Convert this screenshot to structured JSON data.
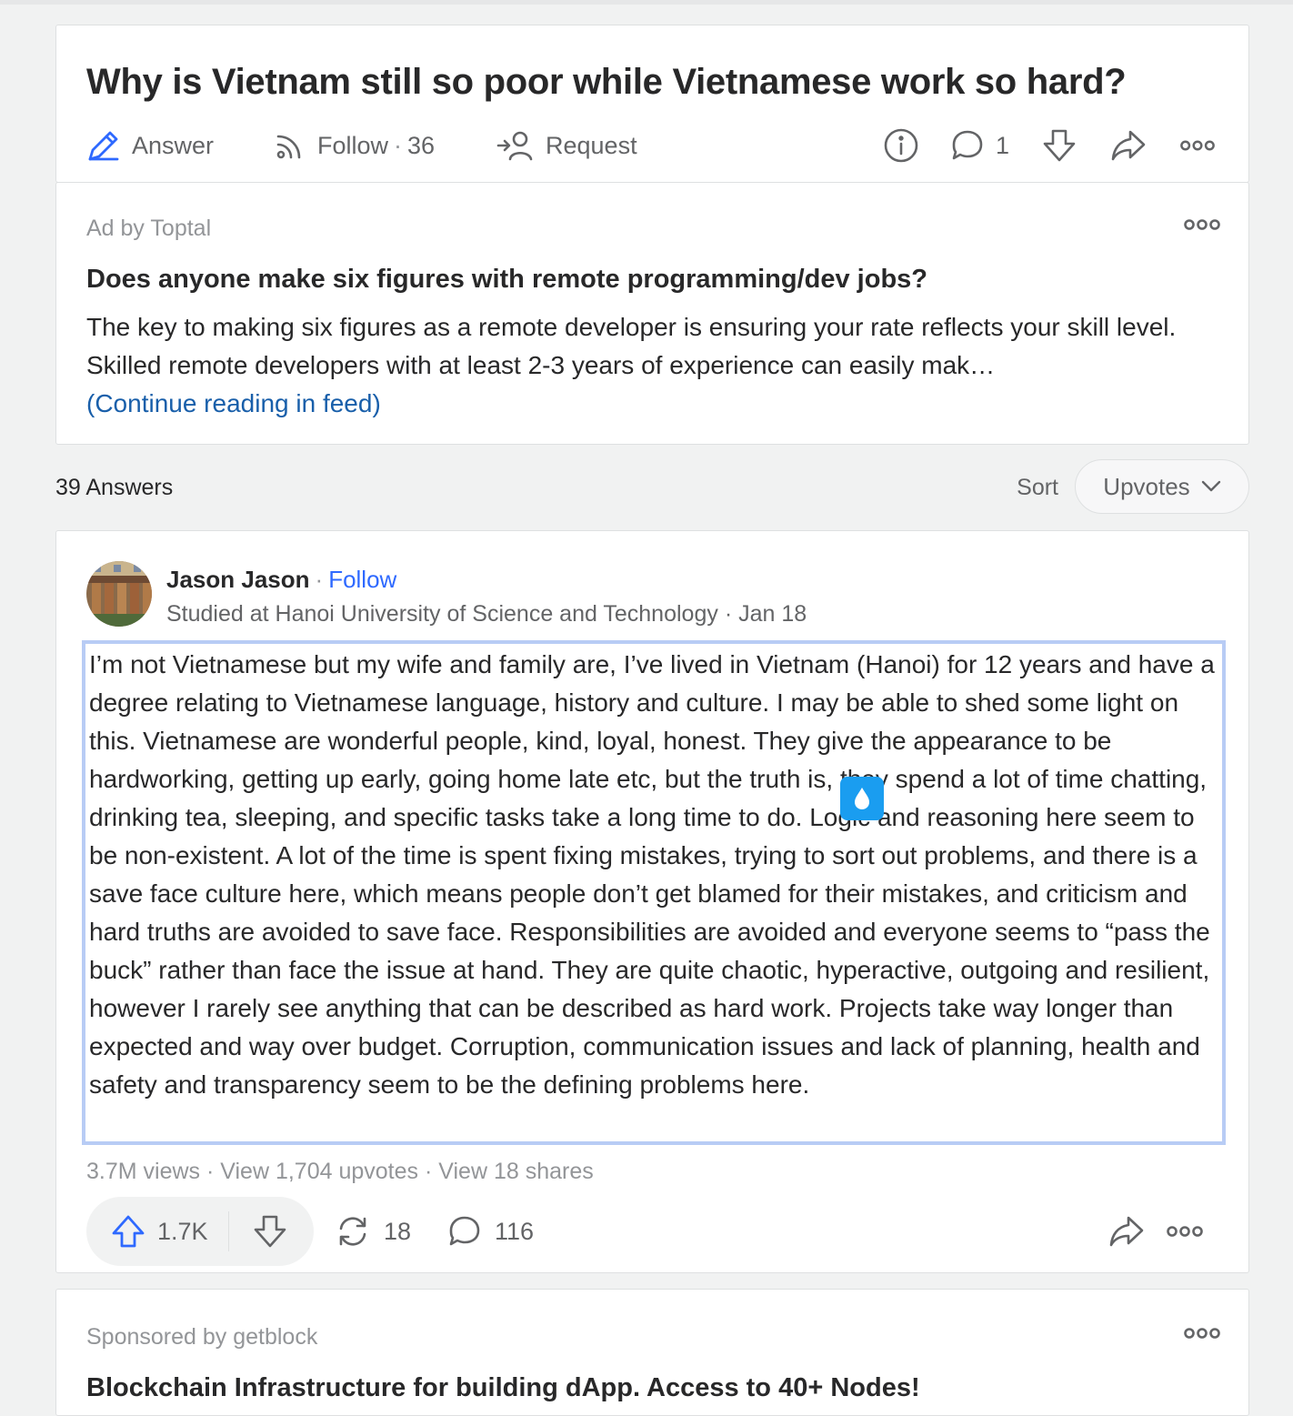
{
  "question": {
    "title": "Why is Vietnam still so poor while Vietnamese work so hard?",
    "answer_label": "Answer",
    "follow_label": "Follow",
    "follow_count": "36",
    "request_label": "Request",
    "comment_count": "1"
  },
  "ad": {
    "label": "Ad by Toptal",
    "title": "Does anyone make six figures with remote programming/dev jobs?",
    "body": "The key to making six figures as a remote developer is ensuring your rate reflects your skill level. Skilled remote developers with at least 2-3 years of experience can easily mak…",
    "link": "(Continue reading in feed)"
  },
  "answers_header": {
    "count_label": "39 Answers",
    "sort_label": "Sort",
    "sort_value": "Upvotes"
  },
  "answer": {
    "author_name": "Jason Jason",
    "follow_label": "Follow",
    "credential": "Studied at Hanoi University of Science and Technology",
    "date": "Jan 18",
    "body": "I’m not Vietnamese but my wife and family are, I’ve lived in Vietnam (Hanoi) for 12 years and have a degree relating to Vietnamese language, history and culture. I may be able to shed some light on this. Vietnamese are wonderful people, kind, loyal, honest. They give the appearance to be hardworking, getting up early, going home late etc, but the truth is, they spend a lot of time chatting, drinking tea, sleeping, and specific tasks take a long time to do. Logic and reasoning here seem to be non-existent. A lot of the time is spent fixing mistakes, trying to sort out problems, and there is a save face culture here, which means people don’t get blamed for their mistakes, and criticism and hard truths are avoided to save face. Responsibilities are avoided and everyone seems to “pass the buck” rather than face the issue at hand. They are quite chaotic, hyperactive, outgoing and resilient, however I rarely see anything that can be described as hard work. Projects take way longer than expected and way over budget. Corruption, communication issues and lack of planning, health and safety and transparency seem to be the defining problems here.",
    "views": "3.7M views",
    "upvotes_link": "View 1,704 upvotes",
    "shares_link": "View 18 shares",
    "upvote_count": "1.7K",
    "share_count": "18",
    "comment_count": "116"
  },
  "sponsored": {
    "label": "Sponsored by getblock",
    "title": "Blockchain Infrastructure for building dApp. Access to 40+ Nodes!"
  },
  "colors": {
    "accent_blue": "#2e69ff",
    "link_blue": "#195faa",
    "muted_text": "#939598",
    "selection_border": "#b8ccf5",
    "badge_blue": "#1a9df0"
  },
  "icons": [
    "pencil-answer-icon",
    "follow-rss-icon",
    "request-person-icon",
    "info-icon",
    "comment-icon",
    "downvote-icon",
    "share-icon",
    "more-icon",
    "chevron-down-icon",
    "upvote-icon",
    "reshare-icon",
    "drop-icon"
  ]
}
